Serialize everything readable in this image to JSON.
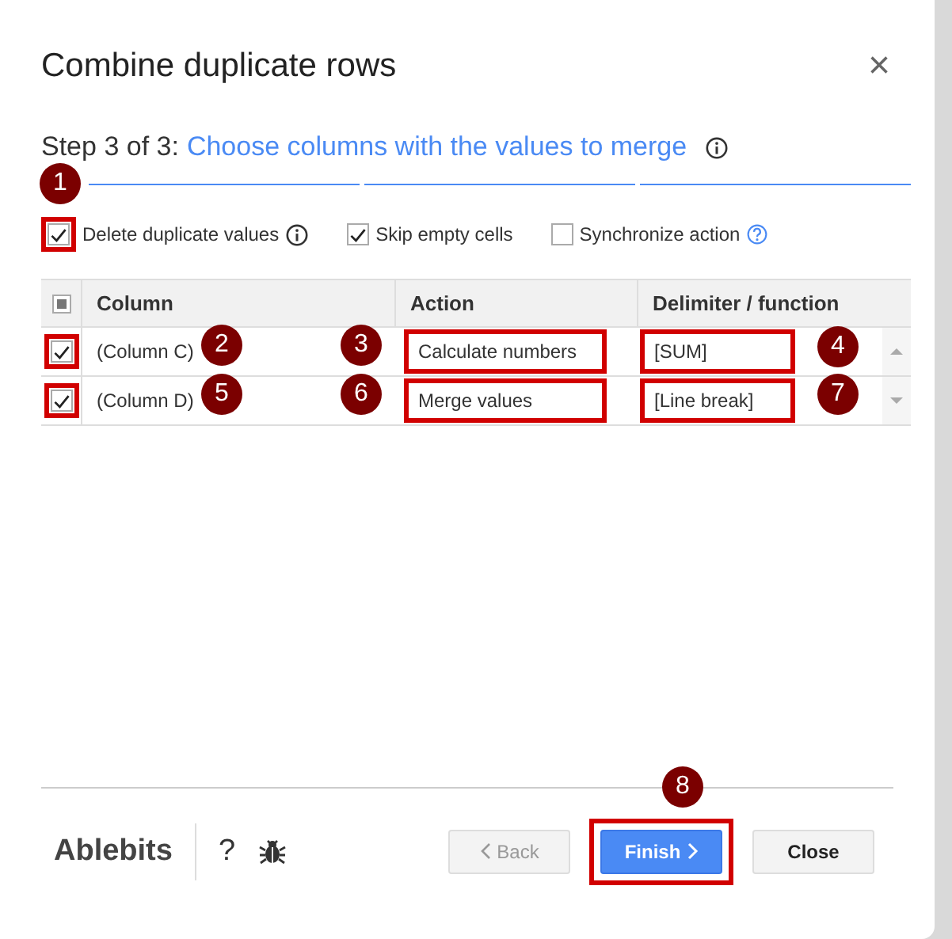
{
  "window": {
    "title": "Combine duplicate rows",
    "close": "×"
  },
  "step": {
    "prefix": "Step 3 of 3:",
    "text": "Choose columns with the values to merge"
  },
  "progress": [
    {
      "done": true
    },
    {
      "done": true
    },
    {
      "done": true
    }
  ],
  "options": [
    {
      "label": "Delete duplicate values",
      "checked": true,
      "highlight": true,
      "kind": "info"
    },
    {
      "label": "Skip empty cells",
      "checked": true,
      "highlight": false,
      "kind": "plain"
    },
    {
      "label": "Synchronize action",
      "checked": false,
      "highlight": false,
      "kind": "help"
    }
  ],
  "table": {
    "columns": [
      "Column",
      "Action",
      "Delimiter / function"
    ],
    "all_indeterminate": true,
    "rows": [
      {
        "checked": true,
        "column": "(Column C)",
        "action": "Calculate numbers",
        "delimiter": "[SUM]",
        "highlight": true
      },
      {
        "checked": true,
        "column": "(Column D)",
        "action": "Merge values",
        "delimiter": "[Line break]",
        "highlight": true
      }
    ]
  },
  "footer": {
    "brand": "Ablebits",
    "help": "?",
    "buttons": [
      {
        "label": "Back",
        "kind": "back",
        "disabled": true,
        "highlight": false
      },
      {
        "label": "Finish",
        "kind": "primary",
        "disabled": false,
        "highlight": true
      },
      {
        "label": "Close",
        "kind": "plain",
        "disabled": false,
        "highlight": false
      }
    ]
  },
  "markers": [
    "1",
    "2",
    "3",
    "4",
    "5",
    "6",
    "7",
    "8"
  ]
}
